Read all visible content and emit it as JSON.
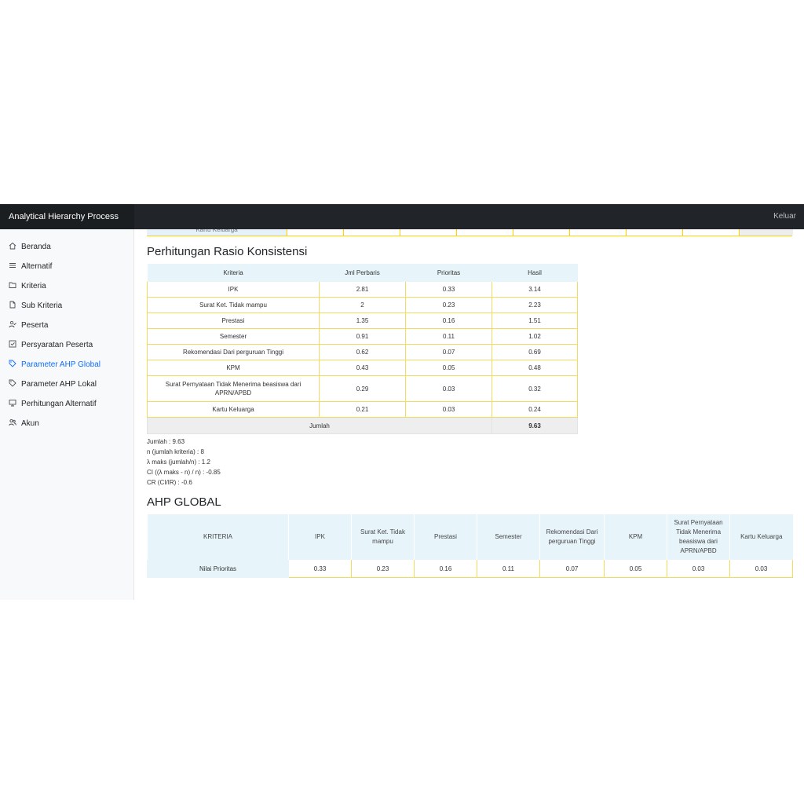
{
  "navbar": {
    "brand": "Analytical Hierarchy Process",
    "logout": "Keluar"
  },
  "sidebar": {
    "items": [
      {
        "label": "Beranda",
        "icon": "home-icon",
        "active": false
      },
      {
        "label": "Alternatif",
        "icon": "list-icon",
        "active": false
      },
      {
        "label": "Kriteria",
        "icon": "folder-icon",
        "active": false
      },
      {
        "label": "Sub Kriteria",
        "icon": "file-icon",
        "active": false
      },
      {
        "label": "Peserta",
        "icon": "user-check-icon",
        "active": false
      },
      {
        "label": "Persyaratan Peserta",
        "icon": "checkbox-icon",
        "active": false
      },
      {
        "label": "Parameter AHP Global",
        "icon": "tag-icon",
        "active": true
      },
      {
        "label": "Parameter AHP Lokal",
        "icon": "tag-icon",
        "active": false
      },
      {
        "label": "Perhitungan Alternatif",
        "icon": "monitor-icon",
        "active": false
      },
      {
        "label": "Akun",
        "icon": "users-icon",
        "active": false
      }
    ],
    "active_color": "#0d6efd"
  },
  "peek_row": {
    "label": "Kartu Keluarga"
  },
  "rasio": {
    "title": "Perhitungan Rasio Konsistensi",
    "headers": [
      "Kriteria",
      "Jml Perbaris",
      "Prioritas",
      "Hasil"
    ],
    "rows": [
      [
        "IPK",
        "2.81",
        "0.33",
        "3.14"
      ],
      [
        "Surat Ket. Tidak mampu",
        "2",
        "0.23",
        "2.23"
      ],
      [
        "Prestasi",
        "1.35",
        "0.16",
        "1.51"
      ],
      [
        "Semester",
        "0.91",
        "0.11",
        "1.02"
      ],
      [
        "Rekomendasi Dari perguruan Tinggi",
        "0.62",
        "0.07",
        "0.69"
      ],
      [
        "KPM",
        "0.43",
        "0.05",
        "0.48"
      ],
      [
        "Surat Pernyataan Tidak Menerima beasiswa dari APRN/APBD",
        "0.29",
        "0.03",
        "0.32"
      ],
      [
        "Kartu Keluarga",
        "0.21",
        "0.03",
        "0.24"
      ]
    ],
    "total_label": "Jumlah",
    "total_value": "9.63"
  },
  "summary": [
    "Jumlah : 9.63",
    "n (jumlah kriteria) : 8",
    "λ maks (jumlah/n) : 1.2",
    "CI ((λ maks - n) / n) : -0.85",
    "CR (CI/IR) : -0.6"
  ],
  "global": {
    "title": "AHP GLOBAL",
    "headers": [
      "KRITERIA",
      "IPK",
      "Surat Ket. Tidak mampu",
      "Prestasi",
      "Semester",
      "Rekomendasi Dari perguruan Tinggi",
      "KPM",
      "Surat Pernyataan Tidak Menerima beasiswa dari APRN/APBD",
      "Kartu Keluarga"
    ],
    "row_label": "Nilai Prioritas",
    "values": [
      "0.33",
      "0.23",
      "0.16",
      "0.11",
      "0.07",
      "0.05",
      "0.03",
      "0.03"
    ]
  },
  "colors": {
    "navbar": "#212529",
    "header_bg": "#e7f5fb",
    "table_border": "#f2dc5d",
    "total_bg": "#eeeeee"
  }
}
